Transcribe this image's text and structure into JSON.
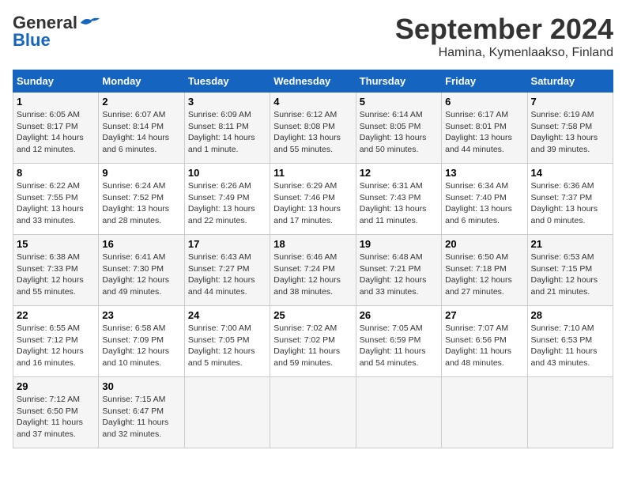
{
  "header": {
    "logo_general": "General",
    "logo_blue": "Blue",
    "month_title": "September 2024",
    "location": "Hamina, Kymenlaakso, Finland"
  },
  "days_of_week": [
    "Sunday",
    "Monday",
    "Tuesday",
    "Wednesday",
    "Thursday",
    "Friday",
    "Saturday"
  ],
  "weeks": [
    [
      {
        "day": "1",
        "sunrise": "6:05 AM",
        "sunset": "8:17 PM",
        "daylight": "14 hours and 12 minutes."
      },
      {
        "day": "2",
        "sunrise": "6:07 AM",
        "sunset": "8:14 PM",
        "daylight": "14 hours and 6 minutes."
      },
      {
        "day": "3",
        "sunrise": "6:09 AM",
        "sunset": "8:11 PM",
        "daylight": "14 hours and 1 minute."
      },
      {
        "day": "4",
        "sunrise": "6:12 AM",
        "sunset": "8:08 PM",
        "daylight": "13 hours and 55 minutes."
      },
      {
        "day": "5",
        "sunrise": "6:14 AM",
        "sunset": "8:05 PM",
        "daylight": "13 hours and 50 minutes."
      },
      {
        "day": "6",
        "sunrise": "6:17 AM",
        "sunset": "8:01 PM",
        "daylight": "13 hours and 44 minutes."
      },
      {
        "day": "7",
        "sunrise": "6:19 AM",
        "sunset": "7:58 PM",
        "daylight": "13 hours and 39 minutes."
      }
    ],
    [
      {
        "day": "8",
        "sunrise": "6:22 AM",
        "sunset": "7:55 PM",
        "daylight": "13 hours and 33 minutes."
      },
      {
        "day": "9",
        "sunrise": "6:24 AM",
        "sunset": "7:52 PM",
        "daylight": "13 hours and 28 minutes."
      },
      {
        "day": "10",
        "sunrise": "6:26 AM",
        "sunset": "7:49 PM",
        "daylight": "13 hours and 22 minutes."
      },
      {
        "day": "11",
        "sunrise": "6:29 AM",
        "sunset": "7:46 PM",
        "daylight": "13 hours and 17 minutes."
      },
      {
        "day": "12",
        "sunrise": "6:31 AM",
        "sunset": "7:43 PM",
        "daylight": "13 hours and 11 minutes."
      },
      {
        "day": "13",
        "sunrise": "6:34 AM",
        "sunset": "7:40 PM",
        "daylight": "13 hours and 6 minutes."
      },
      {
        "day": "14",
        "sunrise": "6:36 AM",
        "sunset": "7:37 PM",
        "daylight": "13 hours and 0 minutes."
      }
    ],
    [
      {
        "day": "15",
        "sunrise": "6:38 AM",
        "sunset": "7:33 PM",
        "daylight": "12 hours and 55 minutes."
      },
      {
        "day": "16",
        "sunrise": "6:41 AM",
        "sunset": "7:30 PM",
        "daylight": "12 hours and 49 minutes."
      },
      {
        "day": "17",
        "sunrise": "6:43 AM",
        "sunset": "7:27 PM",
        "daylight": "12 hours and 44 minutes."
      },
      {
        "day": "18",
        "sunrise": "6:46 AM",
        "sunset": "7:24 PM",
        "daylight": "12 hours and 38 minutes."
      },
      {
        "day": "19",
        "sunrise": "6:48 AM",
        "sunset": "7:21 PM",
        "daylight": "12 hours and 33 minutes."
      },
      {
        "day": "20",
        "sunrise": "6:50 AM",
        "sunset": "7:18 PM",
        "daylight": "12 hours and 27 minutes."
      },
      {
        "day": "21",
        "sunrise": "6:53 AM",
        "sunset": "7:15 PM",
        "daylight": "12 hours and 21 minutes."
      }
    ],
    [
      {
        "day": "22",
        "sunrise": "6:55 AM",
        "sunset": "7:12 PM",
        "daylight": "12 hours and 16 minutes."
      },
      {
        "day": "23",
        "sunrise": "6:58 AM",
        "sunset": "7:09 PM",
        "daylight": "12 hours and 10 minutes."
      },
      {
        "day": "24",
        "sunrise": "7:00 AM",
        "sunset": "7:05 PM",
        "daylight": "12 hours and 5 minutes."
      },
      {
        "day": "25",
        "sunrise": "7:02 AM",
        "sunset": "7:02 PM",
        "daylight": "11 hours and 59 minutes."
      },
      {
        "day": "26",
        "sunrise": "7:05 AM",
        "sunset": "6:59 PM",
        "daylight": "11 hours and 54 minutes."
      },
      {
        "day": "27",
        "sunrise": "7:07 AM",
        "sunset": "6:56 PM",
        "daylight": "11 hours and 48 minutes."
      },
      {
        "day": "28",
        "sunrise": "7:10 AM",
        "sunset": "6:53 PM",
        "daylight": "11 hours and 43 minutes."
      }
    ],
    [
      {
        "day": "29",
        "sunrise": "7:12 AM",
        "sunset": "6:50 PM",
        "daylight": "11 hours and 37 minutes."
      },
      {
        "day": "30",
        "sunrise": "7:15 AM",
        "sunset": "6:47 PM",
        "daylight": "11 hours and 32 minutes."
      },
      null,
      null,
      null,
      null,
      null
    ]
  ]
}
